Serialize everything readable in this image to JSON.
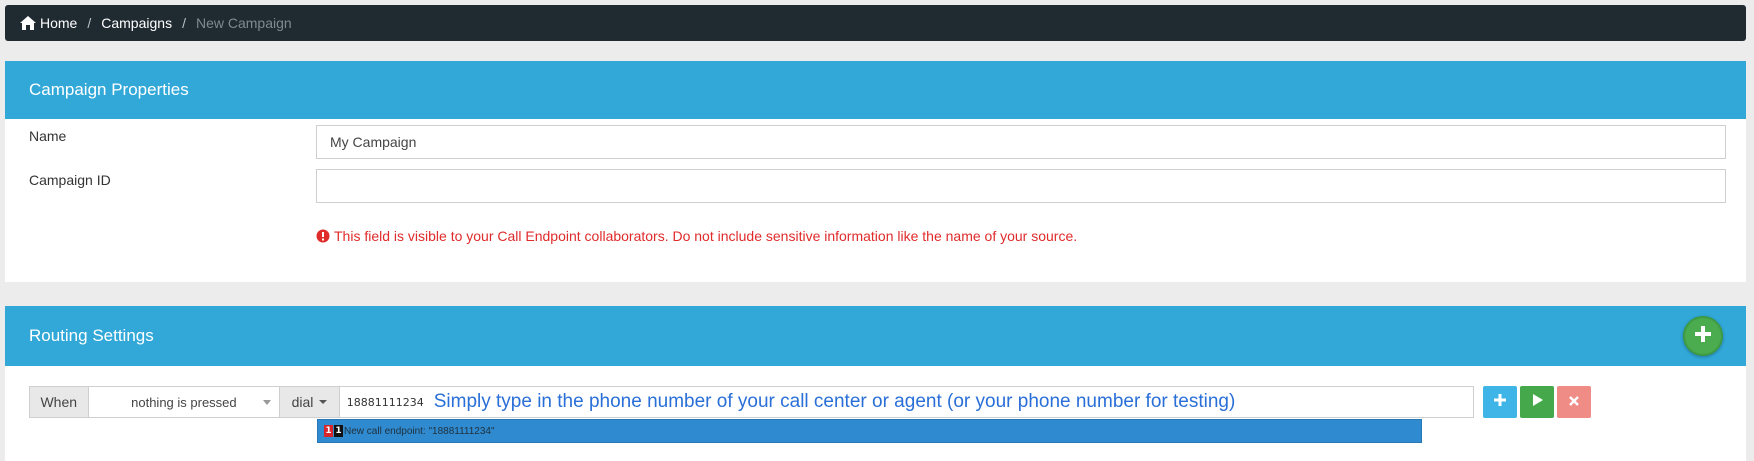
{
  "breadcrumb": {
    "home": "Home",
    "campaigns": "Campaigns",
    "current": "New Campaign",
    "separator": "/"
  },
  "properties": {
    "title": "Campaign Properties",
    "name_label": "Name",
    "name_value": "My Campaign",
    "campaign_id_label": "Campaign ID",
    "campaign_id_value": "",
    "warning": "This field is visible to your Call Endpoint collaborators. Do not include sensitive information like the name of your source."
  },
  "routing": {
    "title": "Routing Settings",
    "when_label": "When",
    "condition_selected": "nothing is pressed",
    "action_selected": "dial",
    "phone_value": "18881111234",
    "hint": "Simply type in the phone number of your call center or agent (or your phone number for testing)",
    "suggestion": {
      "badge1": "1",
      "badge2": "1",
      "text": "New call endpoint: \"18881111234\""
    }
  },
  "icons": {
    "home": "home-icon",
    "warning": "exclamation-circle-icon",
    "add_route": "plus-icon",
    "add": "plus-icon",
    "play": "play-icon",
    "remove": "close-icon"
  },
  "colors": {
    "breadcrumb_bg": "#1f2a31",
    "panel_header": "#31a8d8",
    "warning": "#e02b2b",
    "green": "#45a84a",
    "blue_btn": "#3eb5e6",
    "red_btn": "#ef8c86",
    "hint": "#2a6fd8",
    "suggestion_bg": "#2f8ad0"
  }
}
